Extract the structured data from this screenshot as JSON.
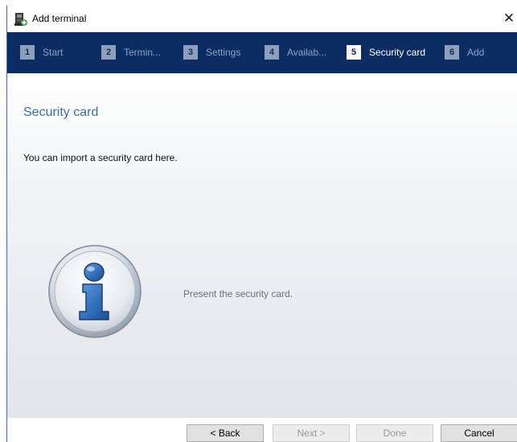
{
  "window": {
    "title": "Add terminal",
    "close_glyph": "✕",
    "icon": "terminal-app-icon"
  },
  "steps": [
    {
      "number": "1",
      "label": "Start"
    },
    {
      "number": "2",
      "label": "Termin..."
    },
    {
      "number": "3",
      "label": "Settings"
    },
    {
      "number": "4",
      "label": "Availab..."
    },
    {
      "number": "5",
      "label": "Security card",
      "active": true
    },
    {
      "number": "6",
      "label": "Add"
    }
  ],
  "content": {
    "section_title": "Security card",
    "description": "You can import a security card here.",
    "status_message": "Present the security card.",
    "icon": "info-icon"
  },
  "buttons": {
    "back": "< Back",
    "next": "Next >",
    "done": "Done",
    "cancel": "Cancel"
  },
  "colors": {
    "step_bar": "#0c2d64",
    "section_title": "#3d6fa8",
    "accent": "#3d6db5"
  }
}
